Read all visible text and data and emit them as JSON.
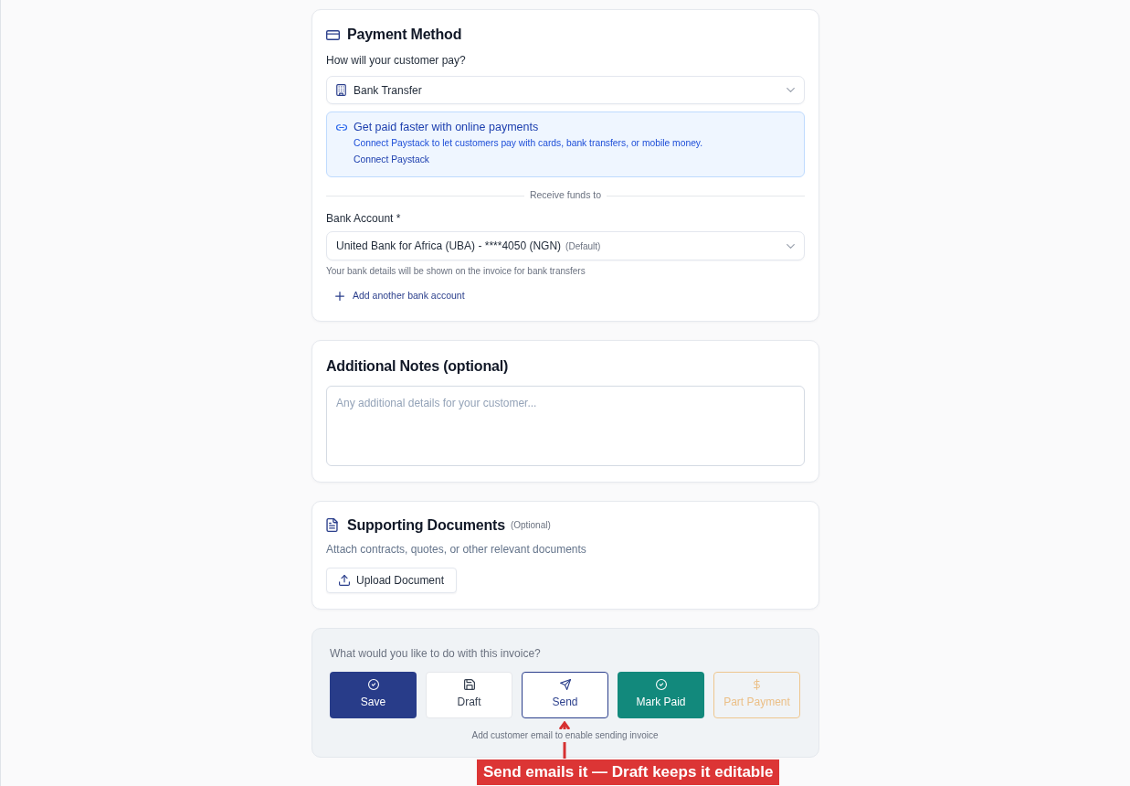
{
  "payment_method": {
    "title": "Payment Method",
    "question": "How will your customer pay?",
    "method_select": {
      "value": "Bank Transfer"
    },
    "online_payments_notice": {
      "title": "Get paid faster with online payments",
      "text": "Connect Paystack to let customers pay with cards, bank transfers, or mobile money.",
      "link": "Connect Paystack"
    },
    "divider_label": "Receive funds to",
    "bank_account": {
      "label": "Bank Account *",
      "value": "United Bank for Africa (UBA) - ****4050 (NGN)",
      "tag": "(Default)",
      "help": "Your bank details will be shown on the invoice for bank transfers"
    },
    "add_account_link": "Add another bank account"
  },
  "additional_notes": {
    "title": "Additional Notes (optional)",
    "placeholder": "Any additional details for your customer..."
  },
  "supporting_documents": {
    "title": "Supporting Documents",
    "tag": "(Optional)",
    "description": "Attach contracts, quotes, or other relevant documents",
    "upload_button": "Upload Document"
  },
  "actions": {
    "question": "What would you like to do with this invoice?",
    "buttons": [
      {
        "label": "Save",
        "kind": "save",
        "disabled": false
      },
      {
        "label": "Draft",
        "kind": "draft",
        "disabled": false
      },
      {
        "label": "Send",
        "kind": "send",
        "disabled": false
      },
      {
        "label": "Mark Paid",
        "kind": "mark_paid",
        "disabled": false
      },
      {
        "label": "Part Payment",
        "kind": "part_payment",
        "disabled": true
      }
    ],
    "hint": "Add customer email to enable sending invoice"
  },
  "annotation": {
    "text": "Send emails it — Draft keeps it editable"
  }
}
